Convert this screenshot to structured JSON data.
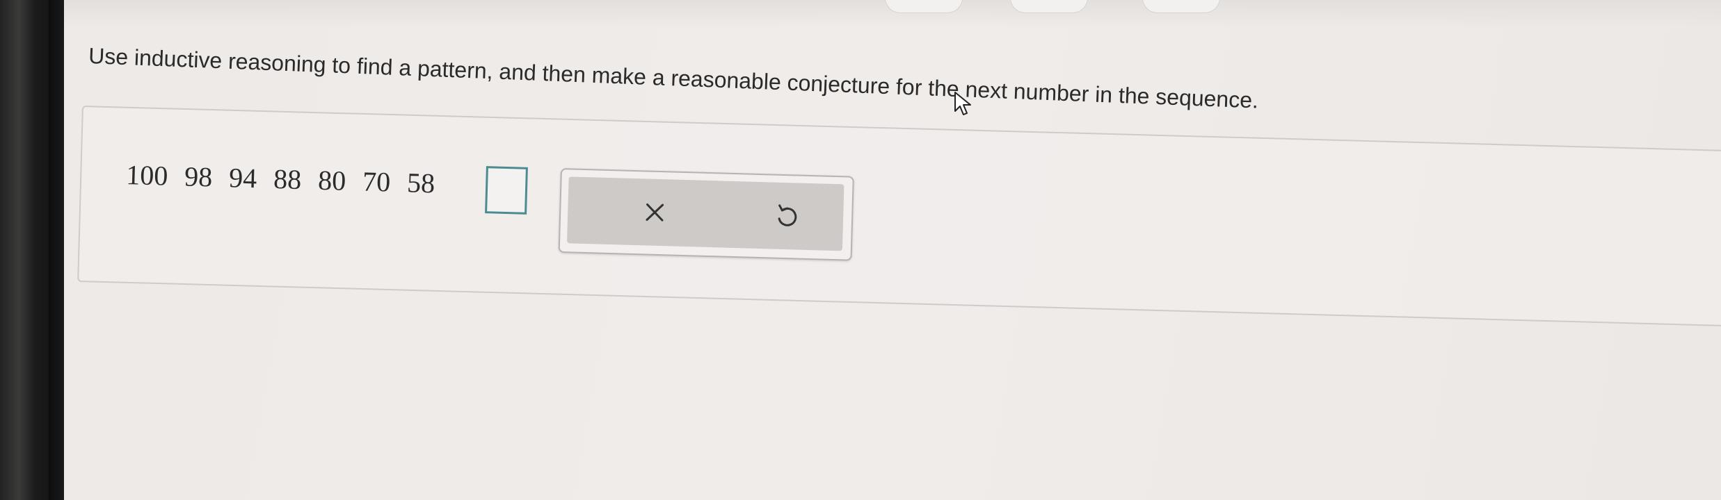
{
  "question": {
    "text": "Use inductive reasoning to find a pattern, and then make a reasonable conjecture for the next number in the sequence."
  },
  "sequence": {
    "display": "100 98 94 88 80 70 58",
    "values": [
      100,
      98,
      94,
      88,
      80,
      70,
      58
    ]
  },
  "answer_input": {
    "value": ""
  },
  "toolbox": {
    "clear_icon": "close-icon",
    "undo_icon": "undo-icon"
  },
  "colors": {
    "answer_box_border": "#4a8c92",
    "toolbox_background": "#cdcac8"
  }
}
